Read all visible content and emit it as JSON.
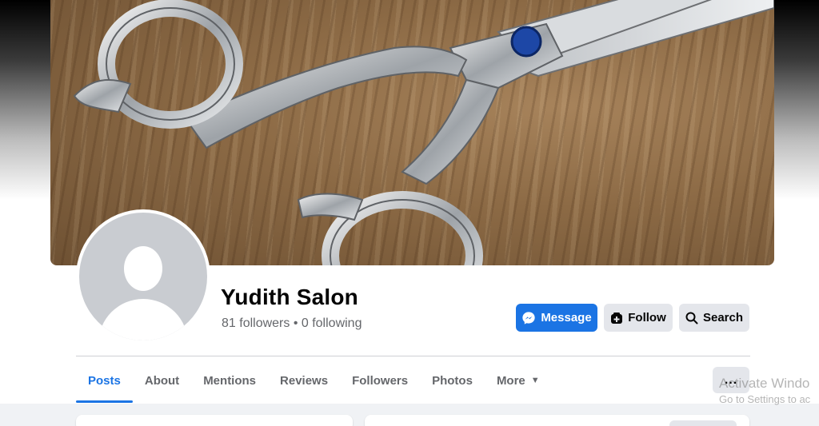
{
  "page": {
    "name": "Yudith Salon",
    "stats": "81 followers • 0 following"
  },
  "actions": {
    "message": "Message",
    "follow": "Follow",
    "search": "Search"
  },
  "tabs": [
    {
      "label": "Posts"
    },
    {
      "label": "About"
    },
    {
      "label": "Mentions"
    },
    {
      "label": "Reviews"
    },
    {
      "label": "Followers"
    },
    {
      "label": "Photos"
    },
    {
      "label": "More"
    }
  ],
  "more_menu": {
    "label": "..."
  },
  "watermark": {
    "line1": "Activate Windo",
    "line2": "Go to Settings to ac"
  },
  "colors": {
    "accent": "#1b74e4",
    "button_gray": "#e4e6eb",
    "text_secondary": "#65676b"
  },
  "icons": {
    "message": "messenger-icon",
    "follow": "follow-icon",
    "search": "search-icon",
    "more_tab": "caret-down-icon"
  }
}
